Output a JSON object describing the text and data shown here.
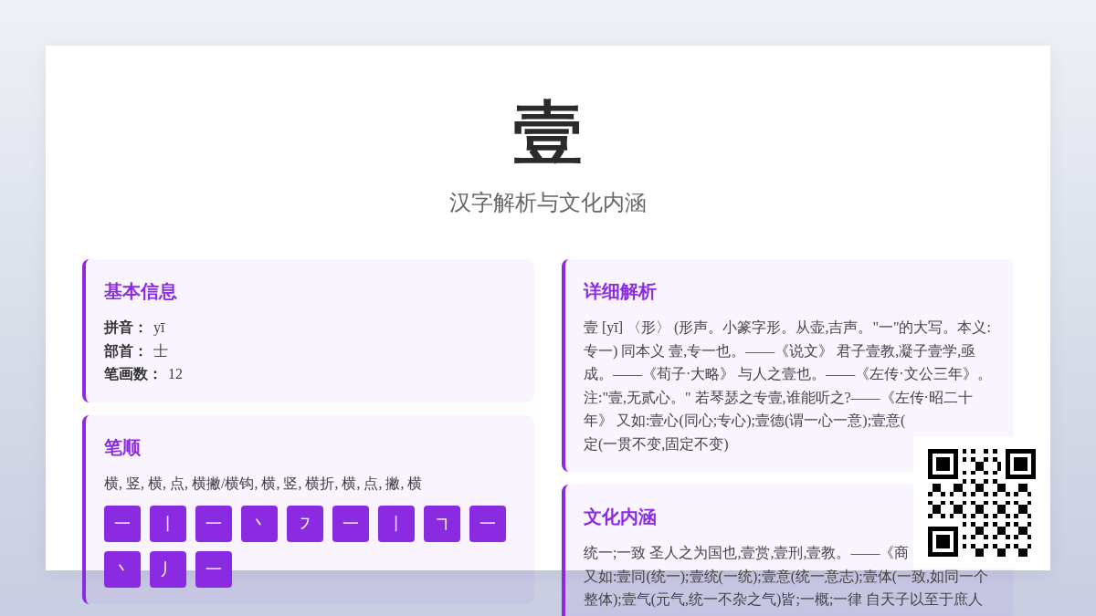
{
  "title": "壹",
  "subtitle": "汉字解析与文化内涵",
  "basic_info": {
    "heading": "基本信息",
    "fields": [
      {
        "label": "拼音：",
        "value": "yī"
      },
      {
        "label": "部首：",
        "value": "士"
      },
      {
        "label": "笔画数：",
        "value": "12"
      }
    ]
  },
  "stroke_order": {
    "heading": "笔顺",
    "names": "横, 竖, 横, 点, 横撇/横钩, 横, 竖, 横折, 横, 点, 撇, 横",
    "strokes": [
      "一",
      "丨",
      "一",
      "丶",
      "㇇",
      "一",
      "丨",
      "㇕",
      "一",
      "丶",
      "丿",
      "一"
    ]
  },
  "details": {
    "heading": "详细解析",
    "lines": [
      "壹 [yī] 〈形〉 (形声。小篆字形。从壶,吉声。\"一\"的大写。本义:",
      "专一) 同本义 壹,专一也。——《说文》 君子壹教,凝子壹学,亟",
      "成。——《荀子·大略》 与人之壹也。——《左传·文公三年》。",
      "注:\"壹,无贰心。\" 若琴瑟之专壹,谁能听之?——《左传·昭二十",
      "年》 又如:壹心(同心;专心);壹德(谓一心一意);壹意(",
      "定(一贯不变,固定不变)"
    ]
  },
  "culture": {
    "heading": "文化内涵",
    "lines": [
      "统一;一致 圣人之为国也,壹赏,壹刑,壹教。——《商",
      "又如:壹同(统一);壹统(一统);壹意(统一意志);壹体(一致,如同一个",
      "整体);壹气(元气,统一不杂之气)皆;一概;一律 自天子以至于庶人"
    ]
  }
}
